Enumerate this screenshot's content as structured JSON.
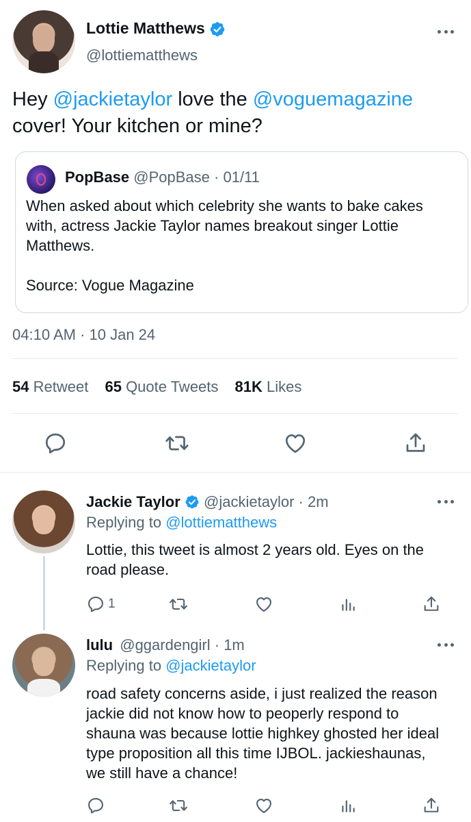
{
  "main_tweet": {
    "author_name": "Lottie Matthews",
    "author_handle": "@lottiematthews",
    "text_parts": [
      {
        "text": "Hey ",
        "type": "plain"
      },
      {
        "text": "@jackietaylor",
        "type": "mention"
      },
      {
        "text": " love the ",
        "type": "plain"
      },
      {
        "text": "@voguemagazine",
        "type": "mention"
      },
      {
        "text": " cover! Your kitchen or mine?",
        "type": "plain"
      }
    ],
    "quoted": {
      "author_name": "PopBase",
      "author_handle": "@PopBase",
      "date": "· 01/11",
      "text": "When asked about which celebrity she wants to bake cakes with, actress Jackie Taylor names breakout singer Lottie Matthews.",
      "source": "Source: Vogue Magazine"
    },
    "timestamp": "04:10 AM · 10 Jan 24",
    "stats": {
      "retweets_count": "54",
      "retweets_label": "Retweet",
      "quotes_count": "65",
      "quotes_label": "Quote Tweets",
      "likes_count": "81K",
      "likes_label": "Likes"
    }
  },
  "replies": [
    {
      "author_name": "Jackie Taylor",
      "author_handle": "@jackietaylor · 2m",
      "replying_prefix": "Replying to ",
      "replying_to": "@lottiematthews",
      "text": "Lottie, this tweet is almost 2 years old. Eyes on the road please.",
      "reply_count": "1"
    },
    {
      "author_name": "lulu",
      "author_handle": "@ggardengirl · 1m",
      "replying_prefix": "Replying to ",
      "replying_to": "@jackietaylor",
      "text": "road safety concerns aside, i just realized the reason jackie did not know how to peoperly respond to shauna was because lottie highkey ghosted her ideal type proposition all this time IJBOL. jackieshaunas, we still have a chance!",
      "reply_count": ""
    }
  ],
  "icons": {
    "reply": "reply-icon",
    "retweet": "retweet-icon",
    "like": "heart-icon",
    "share": "share-icon",
    "analytics": "analytics-icon",
    "more": "more-icon",
    "verified": "verified-badge-icon"
  },
  "colors": {
    "accent": "#1d9bf0",
    "text": "#0f1419",
    "secondary": "#536471",
    "divider": "#e6e9eb"
  }
}
